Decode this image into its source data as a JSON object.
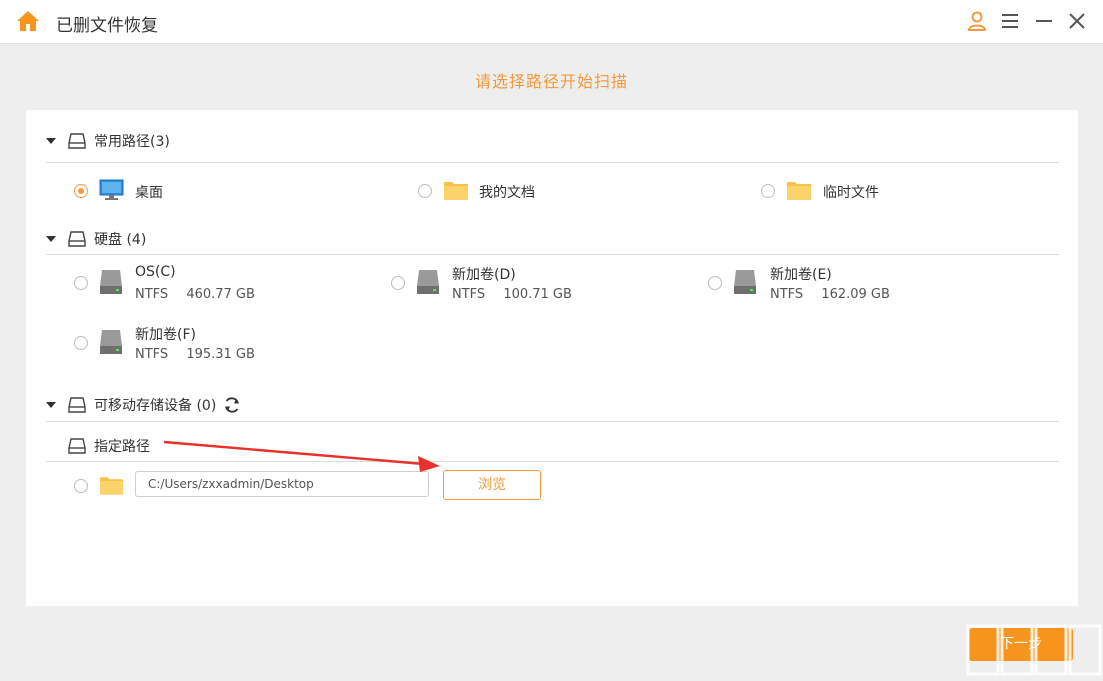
{
  "window": {
    "title": "已删文件恢复",
    "icons": [
      "home-icon",
      "user-icon",
      "menu-icon",
      "minimize-icon",
      "close-icon"
    ]
  },
  "subtitle": "请选择路径开始扫描",
  "sections": {
    "common": {
      "label": "常用路径(3)",
      "items": [
        {
          "label": "桌面",
          "icon": "desktop-icon",
          "selected": true
        },
        {
          "label": "我的文档",
          "icon": "folder-icon",
          "selected": false
        },
        {
          "label": "临时文件",
          "icon": "folder-icon",
          "selected": false
        }
      ]
    },
    "disks": {
      "label": "硬盘 (4)",
      "items": [
        {
          "name": "OS(C)",
          "fs": "NTFS",
          "size": "460.77 GB"
        },
        {
          "name": "新加卷(D)",
          "fs": "NTFS",
          "size": "100.71 GB"
        },
        {
          "name": "新加卷(E)",
          "fs": "NTFS",
          "size": "162.09 GB"
        },
        {
          "name": "新加卷(F)",
          "fs": "NTFS",
          "size": "195.31 GB"
        }
      ]
    },
    "removable": {
      "label": "可移动存储设备 (0)"
    },
    "custom": {
      "label": "指定路径",
      "path_value": "C:/Users/zxxadmin/Desktop",
      "browse_label": "浏览"
    }
  },
  "footer": {
    "next_label": "下一步"
  },
  "colors": {
    "accent": "#f19a3e",
    "button": "#f7941d"
  }
}
